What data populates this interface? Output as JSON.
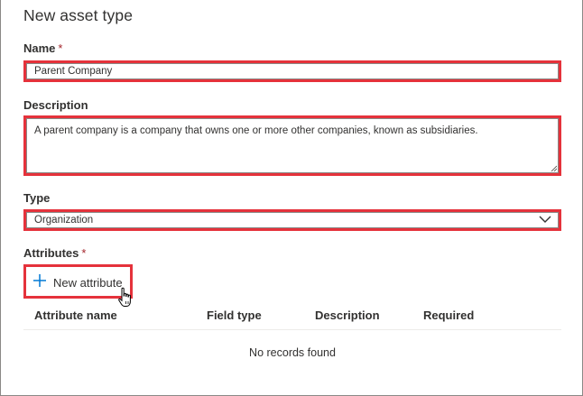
{
  "dialog": {
    "title": "New asset type"
  },
  "name": {
    "label": "Name",
    "required_mark": "*",
    "value": "Parent Company"
  },
  "description": {
    "label": "Description",
    "value": "A parent company is a company that owns one or more other companies, known as subsidiaries."
  },
  "type": {
    "label": "Type",
    "selected": "Organization",
    "icon": "chevron-down-icon"
  },
  "attributes": {
    "label": "Attributes",
    "required_mark": "*",
    "add_button": {
      "label": "New attribute",
      "icon": "plus-icon"
    },
    "columns": [
      "Attribute name",
      "Field type",
      "Description",
      "Required"
    ],
    "empty_text": "No records found"
  },
  "colors": {
    "highlight": "#e5323b",
    "required": "#a4262c",
    "accent": "#0078d4"
  }
}
